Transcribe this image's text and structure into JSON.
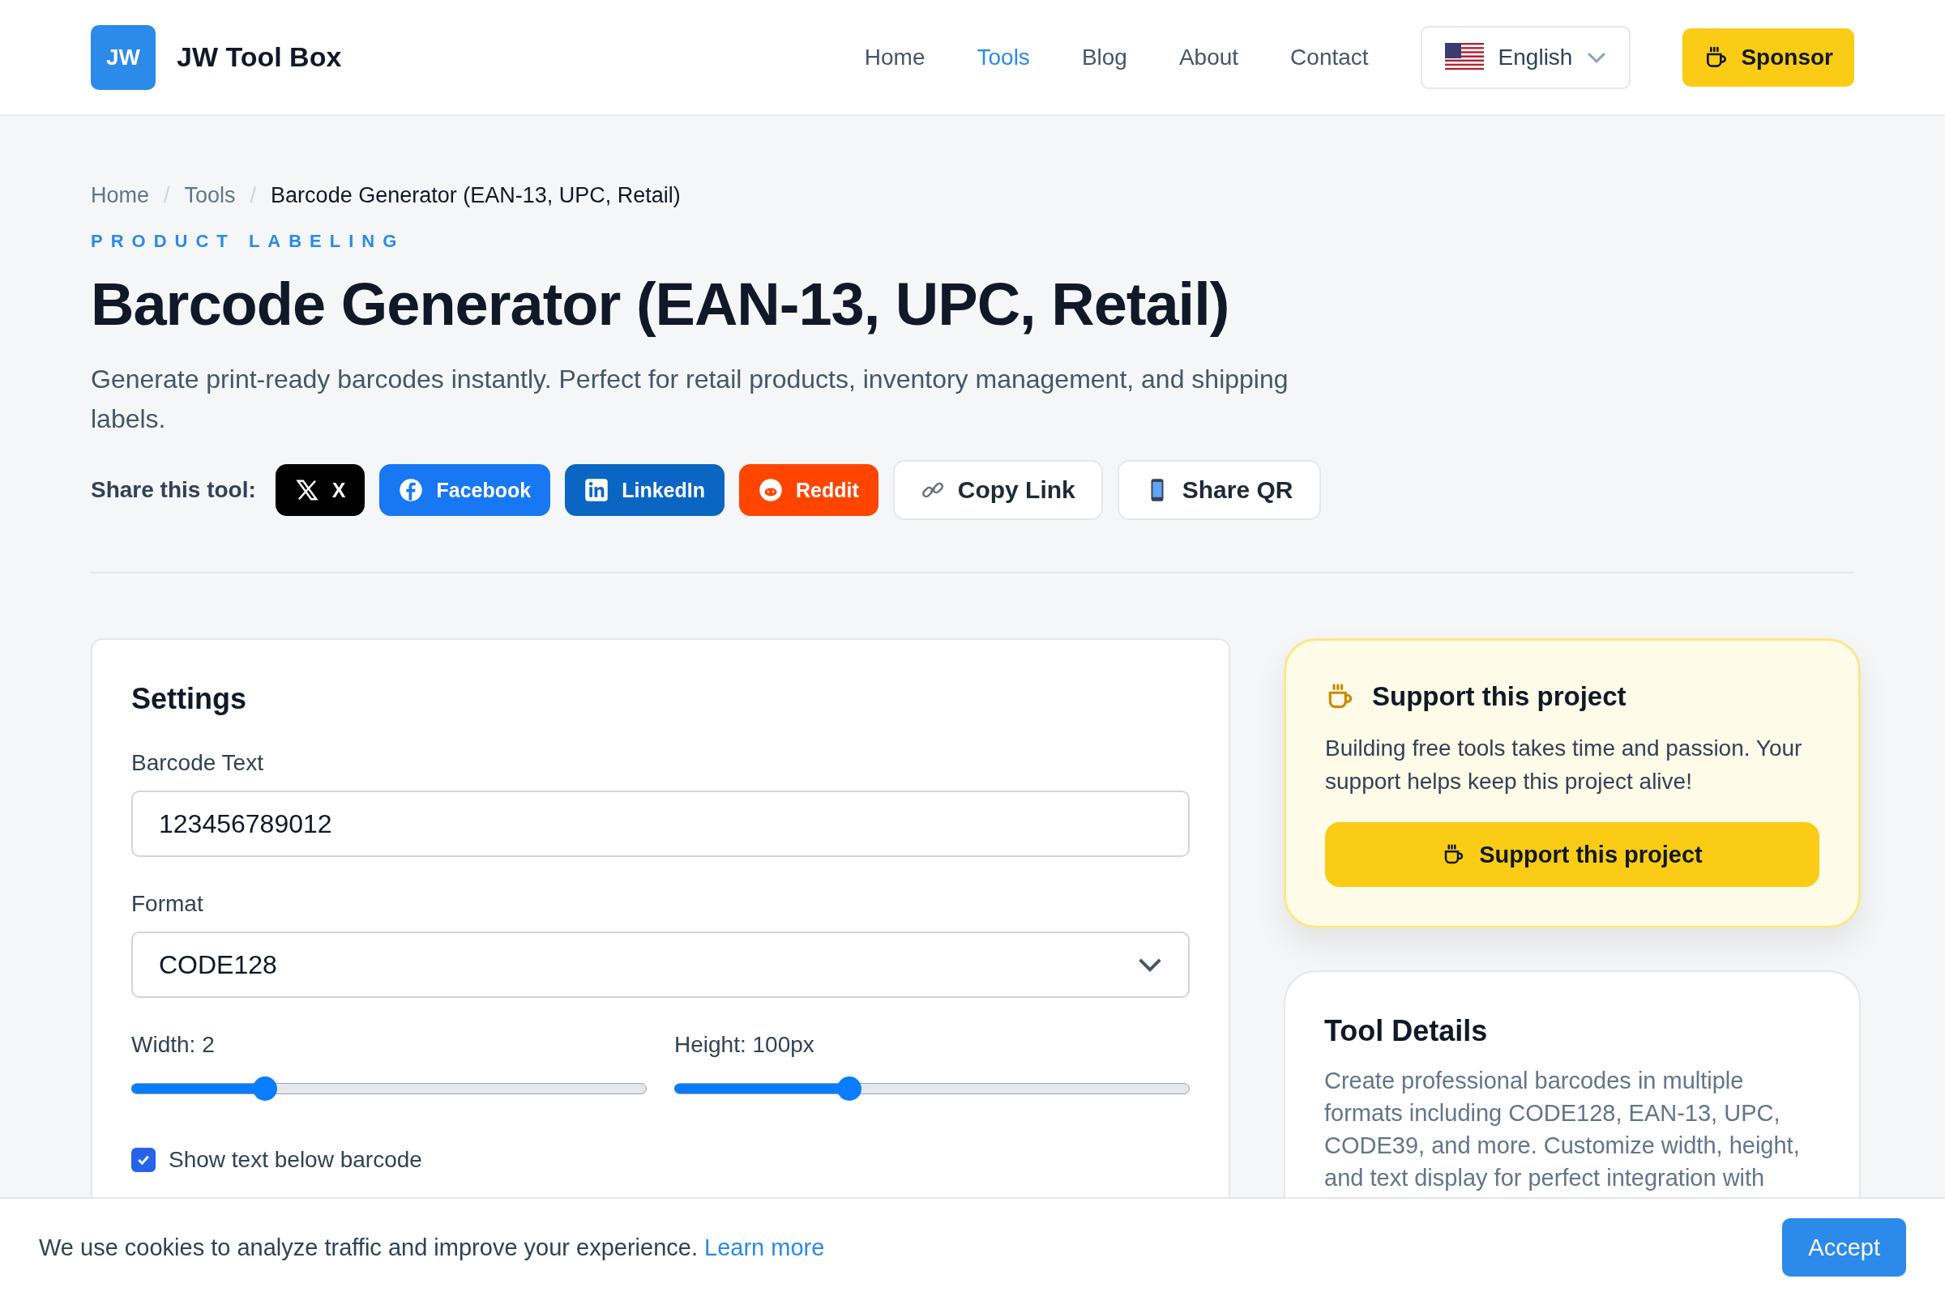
{
  "header": {
    "logo_mark": "JW",
    "site_name": "JW Tool Box",
    "nav": [
      {
        "label": "Home",
        "selected": false
      },
      {
        "label": "Tools",
        "selected": true
      },
      {
        "label": "Blog",
        "selected": false
      },
      {
        "label": "About",
        "selected": false
      },
      {
        "label": "Contact",
        "selected": false
      }
    ],
    "language": "English",
    "sponsor": "Sponsor"
  },
  "breadcrumb": {
    "separator": "/",
    "items": [
      "Home",
      "Tools",
      "Barcode Generator (EAN-13, UPC, Retail)"
    ]
  },
  "category": "PRODUCT LABELING",
  "title": "Barcode Generator (EAN-13, UPC, Retail)",
  "description": "Generate print-ready barcodes instantly. Perfect for retail products, inventory management, and shipping labels.",
  "share": {
    "label": "Share this tool:",
    "buttons": [
      {
        "kind": "x",
        "label": "X"
      },
      {
        "kind": "facebook",
        "label": "Facebook"
      },
      {
        "kind": "linkedin",
        "label": "LinkedIn"
      },
      {
        "kind": "reddit",
        "label": "Reddit"
      },
      {
        "kind": "copy",
        "label": "Copy Link"
      },
      {
        "kind": "qr",
        "label": "Share QR"
      }
    ]
  },
  "settings": {
    "heading": "Settings",
    "barcode_text": {
      "label": "Barcode Text",
      "value": "123456789012"
    },
    "format": {
      "label": "Format",
      "value": "CODE128"
    },
    "sliders": [
      {
        "label": "Width: 2",
        "level": 0.26
      },
      {
        "label": "Height: 100px",
        "level": 0.34
      }
    ],
    "show_text": {
      "label": "Show text below barcode",
      "checked": true
    }
  },
  "support": {
    "title": "Support this project",
    "text": "Building free tools takes time and passion. Your support helps keep this project alive!",
    "button": "Support this project"
  },
  "tool_details": {
    "title": "Tool Details",
    "text": "Create professional barcodes in multiple formats including CODE128, EAN-13, UPC, CODE39, and more. Customize width, height, and text display for perfect integration with"
  },
  "cookie": {
    "text": "We use cookies to analyze traffic and improve your experience.",
    "link": "Learn more",
    "button": "Accept"
  }
}
